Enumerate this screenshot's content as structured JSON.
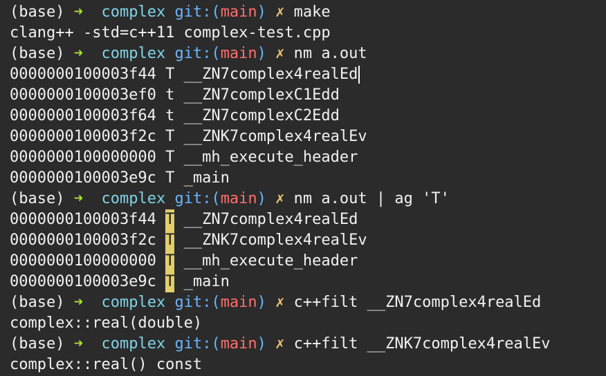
{
  "prompt": {
    "env": "(base)",
    "arrow": "➜",
    "dir": "complex",
    "git_label": "git:(",
    "branch": "main",
    "git_close": ")",
    "dirty": "✗"
  },
  "lines": [
    {
      "type": "prompt",
      "cmd": "make"
    },
    {
      "type": "out",
      "text": "clang++ -std=c++11 complex-test.cpp"
    },
    {
      "type": "prompt",
      "cmd": "nm a.out"
    },
    {
      "type": "out",
      "text": "0000000100003f44 T __ZN7complex4realEd"
    },
    {
      "type": "out",
      "text": "0000000100003ef0 t __ZN7complexC1Edd"
    },
    {
      "type": "out",
      "text": "0000000100003f64 t __ZN7complexC2Edd"
    },
    {
      "type": "out",
      "text": "0000000100003f2c T __ZNK7complex4realEv"
    },
    {
      "type": "out",
      "text": "0000000100000000 T __mh_execute_header"
    },
    {
      "type": "out",
      "text": "0000000100003e9c T _main"
    },
    {
      "type": "prompt",
      "cmd": "nm a.out | ag 'T'"
    },
    {
      "type": "match",
      "addr": "0000000100003f44",
      "sym": "T",
      "name": "__ZN7complex4realEd"
    },
    {
      "type": "match",
      "addr": "0000000100003f2c",
      "sym": "T",
      "name": "__ZNK7complex4realEv"
    },
    {
      "type": "match",
      "addr": "0000000100000000",
      "sym": "T",
      "name": "__mh_execute_header"
    },
    {
      "type": "match",
      "addr": "0000000100003e9c",
      "sym": "T",
      "name": "_main"
    },
    {
      "type": "prompt",
      "cmd": "c++filt __ZN7complex4realEd"
    },
    {
      "type": "out",
      "text": "complex::real(double)"
    },
    {
      "type": "prompt",
      "cmd": "c++filt __ZNK7complex4realEv"
    },
    {
      "type": "out",
      "text": "complex::real() const"
    }
  ],
  "colors": {
    "background": "#2b2b2b",
    "arrow": "#a6e22e",
    "dir": "#7fd3e6",
    "git": "#6cb6ff",
    "branch": "#ff6e6e",
    "dirty": "#f0c674",
    "highlight": "#e2cf6a"
  }
}
